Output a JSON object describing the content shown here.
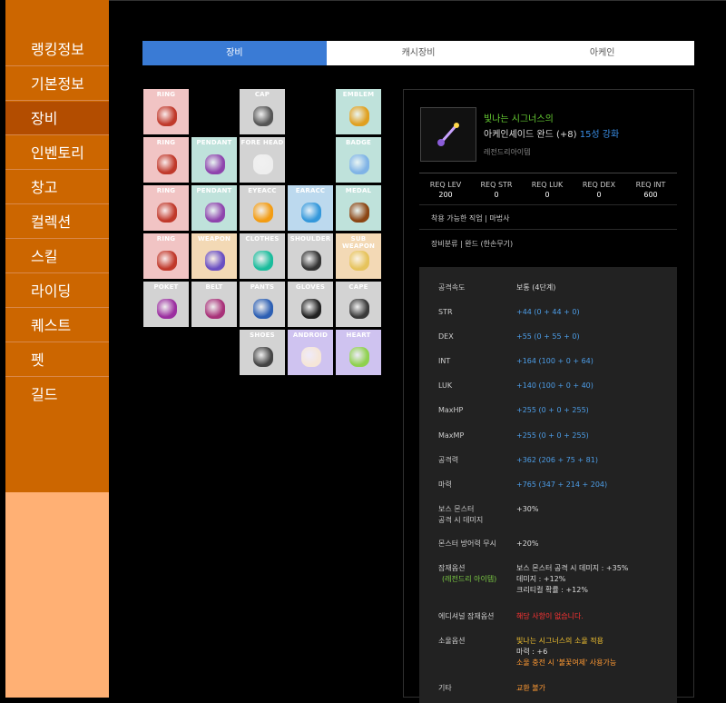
{
  "nav": {
    "items": [
      "랭킹정보",
      "기본정보",
      "장비",
      "인벤토리",
      "창고",
      "컬렉션",
      "스킬",
      "라이딩",
      "퀘스트",
      "펫",
      "길드"
    ],
    "active": 2
  },
  "tabs": [
    "장비",
    "캐시장비",
    "아케인"
  ],
  "slots": [
    {
      "label": "RING",
      "color": "pink",
      "icon": "ring-icon"
    },
    {
      "label": "CAP",
      "color": "grey",
      "icon": "cap-icon"
    },
    {
      "label": "EMBLEM",
      "color": "teal",
      "icon": "emblem-icon"
    },
    {
      "label": "RING",
      "color": "pink",
      "icon": "ring-icon"
    },
    {
      "label": "PENDANT",
      "color": "teal",
      "icon": "pendant-icon"
    },
    {
      "label": "FORE HEAD",
      "color": "grey",
      "icon": "forehead-icon"
    },
    {
      "label": "BADGE",
      "color": "teal",
      "icon": "badge-icon"
    },
    {
      "label": "RING",
      "color": "pink",
      "icon": "ring-icon"
    },
    {
      "label": "PENDANT",
      "color": "teal",
      "icon": "pendant-icon"
    },
    {
      "label": "EYEACC",
      "color": "grey",
      "icon": "eye-accessory-icon"
    },
    {
      "label": "EARACC",
      "color": "lblue",
      "icon": "earring-icon"
    },
    {
      "label": "MEDAL",
      "color": "teal",
      "icon": "medal-icon"
    },
    {
      "label": "RING",
      "color": "pink",
      "icon": "ring-icon"
    },
    {
      "label": "WEAPON",
      "color": "peach",
      "icon": "weapon-icon"
    },
    {
      "label": "CLOTHES",
      "color": "grey",
      "icon": "clothes-icon"
    },
    {
      "label": "SHOULDER",
      "color": "grey",
      "icon": "shoulder-icon"
    },
    {
      "label": "SUB WEAPON",
      "color": "peach",
      "icon": "sub-weapon-icon"
    },
    {
      "label": "POKET",
      "color": "grey",
      "icon": "pocket-icon"
    },
    {
      "label": "BELT",
      "color": "grey",
      "icon": "belt-icon"
    },
    {
      "label": "PANTS",
      "color": "grey",
      "icon": "pants-icon"
    },
    {
      "label": "GLOVES",
      "color": "grey",
      "icon": "gloves-icon"
    },
    {
      "label": "CAPE",
      "color": "grey",
      "icon": "cape-icon"
    },
    {
      "label": "SHOES",
      "color": "grey",
      "icon": "shoes-icon"
    },
    {
      "label": "ANDROID",
      "color": "lav",
      "icon": "android-icon"
    },
    {
      "label": "HEART",
      "color": "lav",
      "icon": "heart-icon"
    }
  ],
  "item": {
    "name": "빛나는 시그너스의",
    "subname": "아케인셰이드 완드 (+8)",
    "star": "15성 강화",
    "grade": "레전드리아이템",
    "icon": "wand-icon"
  },
  "req": [
    {
      "label": "REQ LEV",
      "value": "200"
    },
    {
      "label": "REQ STR",
      "value": "0"
    },
    {
      "label": "REQ LUK",
      "value": "0"
    },
    {
      "label": "REQ DEX",
      "value": "0"
    },
    {
      "label": "REQ INT",
      "value": "600"
    }
  ],
  "jobs": "착용 가능한 직업 | 마법사",
  "category": "장비분류 | 완드 (한손무기)",
  "stats": {
    "atk_speed": {
      "label": "공격속도",
      "value": "보통 (4단계)"
    },
    "str": {
      "label": "STR",
      "value": "+44 (0 + 44 + 0)"
    },
    "dex": {
      "label": "DEX",
      "value": "+55 (0 + 55 + 0)"
    },
    "int": {
      "label": "INT",
      "value": "+164 (100 + 0 + 64)"
    },
    "luk": {
      "label": "LUK",
      "value": "+140 (100 + 0 + 40)"
    },
    "maxhp": {
      "label": "MaxHP",
      "value": "+255 (0 + 0 + 255)"
    },
    "maxmp": {
      "label": "MaxMP",
      "value": "+255 (0 + 0 + 255)"
    },
    "atk": {
      "label": "공격력",
      "value": "+362 (206 + 75 + 81)"
    },
    "matk": {
      "label": "마력",
      "value": "+765 (347 + 214 + 204)"
    },
    "boss": {
      "label1": "보스 몬스터",
      "label2": "공격 시 데미지",
      "value": "+30%"
    },
    "ied": {
      "label": "몬스터 방어력 무시",
      "value": "+20%"
    },
    "potential": {
      "label1": "잠재옵션",
      "label2": "(레전드리 아이템)",
      "line1": "보스 몬스터 공격 시 데미지 : +35%",
      "line2": "데미지 : +12%",
      "line3": "크리티컬 확률 : +12%"
    },
    "additional": {
      "label": "에디셔널 잠재옵션",
      "value": "해당 사항이 없습니다."
    },
    "soul": {
      "label": "소울옵션",
      "line1": "빛나는 시그너스의 소울 적용",
      "line2": "마력 : +6",
      "line3": "소울 충전 시 '불꽃여제' 사용가능"
    },
    "etc": {
      "label": "기타",
      "value": "교환 불가"
    }
  },
  "colors": {
    "sidebar": "#cc6600",
    "sidebar_active": "#b34d00",
    "sidebar_bottom": "#ffb074",
    "tab_active": "#3a7bd5",
    "item_name": "#66cc33",
    "star": "#3a8ee6",
    "stat_blue": "#4d9ee8",
    "warning_red": "#ff3333",
    "soul_yellow": "#f0c030"
  }
}
